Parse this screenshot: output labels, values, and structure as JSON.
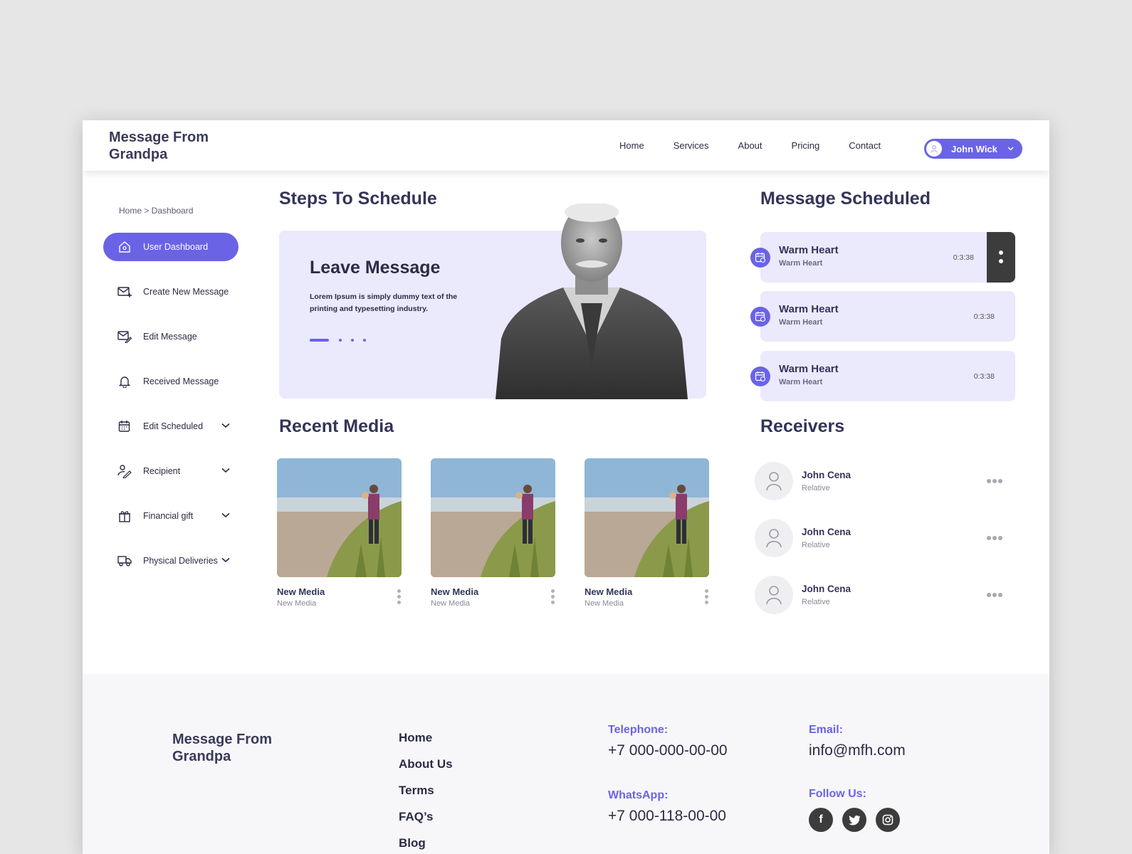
{
  "header": {
    "brand": "Message From Grandpa",
    "nav": [
      "Home",
      "Services",
      "About",
      "Pricing",
      "Contact"
    ],
    "user": "John Wick"
  },
  "sidebar": {
    "breadcrumb": "Home > Dashboard",
    "items": [
      {
        "label": "User Dashboard",
        "icon": "home-icon",
        "active": true
      },
      {
        "label": "Create New Message",
        "icon": "mail-plus-icon"
      },
      {
        "label": "Edit Message",
        "icon": "mail-edit-icon"
      },
      {
        "label": "Received Message",
        "icon": "bell-icon"
      },
      {
        "label": "Edit Scheduled",
        "icon": "calendar-edit-icon",
        "expandable": true
      },
      {
        "label": "Recipient",
        "icon": "person-edit-icon",
        "expandable": true
      },
      {
        "label": "Financial gift",
        "icon": "gift-icon",
        "expandable": true
      },
      {
        "label": "Physical Deliveries",
        "icon": "truck-icon",
        "expandable": true
      }
    ]
  },
  "steps": {
    "heading": "Steps To Schedule",
    "card_title": "Leave Message",
    "card_text": "Lorem Ipsum is simply dummy text of the printing and typesetting industry."
  },
  "recent_media": {
    "heading": "Recent Media",
    "items": [
      {
        "title": "New Media",
        "subtitle": "New Media"
      },
      {
        "title": "New Media",
        "subtitle": "New Media"
      },
      {
        "title": "New Media",
        "subtitle": "New Media"
      }
    ]
  },
  "scheduled": {
    "heading": "Message Scheduled",
    "items": [
      {
        "title": "Warm Heart",
        "subtitle": "Warm Heart",
        "time": "0:3:38"
      },
      {
        "title": "Warm Heart",
        "subtitle": "Warm Heart",
        "time": "0:3:38"
      },
      {
        "title": "Warm Heart",
        "subtitle": "Warm Heart",
        "time": "0:3:38"
      }
    ]
  },
  "receivers": {
    "heading": "Receivers",
    "items": [
      {
        "name": "John Cena",
        "relation": "Relative"
      },
      {
        "name": "John Cena",
        "relation": "Relative"
      },
      {
        "name": "John Cena",
        "relation": "Relative"
      }
    ]
  },
  "footer": {
    "brand": "Message From Grandpa",
    "links": [
      "Home",
      "About Us",
      "Terms",
      "FAQ’s",
      "Blog"
    ],
    "telephone_label": "Telephone:",
    "telephone": "+7 000-000-00-00",
    "whatsapp_label": "WhatsApp:",
    "whatsapp": "+7 000-118-00-00",
    "email_label": "Email:",
    "email": "info@mfh.com",
    "follow_label": "Follow Us:",
    "social": [
      "facebook-icon",
      "twitter-icon",
      "instagram-icon"
    ]
  },
  "colors": {
    "accent": "#6a63e6",
    "card_bg": "#ebe9fc",
    "dark": "#3c3c3c"
  }
}
